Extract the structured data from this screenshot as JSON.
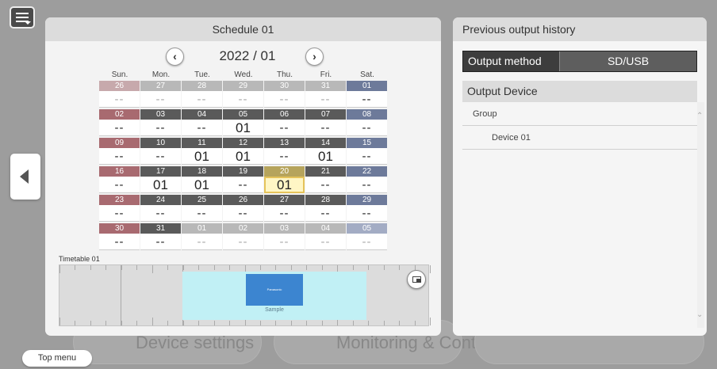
{
  "background": {
    "tiles": [
      {
        "label": "Device settings"
      },
      {
        "label": "Monitoring & Control"
      }
    ]
  },
  "nav": {
    "top_menu_label": "Top menu"
  },
  "schedule": {
    "title": "Schedule 01",
    "month_label": "2022 / 01",
    "weekdays": [
      "Sun.",
      "Mon.",
      "Tue.",
      "Wed.",
      "Thu.",
      "Fri.",
      "Sat."
    ],
    "weeks": [
      [
        {
          "d": "26",
          "v": "--",
          "o": true
        },
        {
          "d": "27",
          "v": "--",
          "o": true
        },
        {
          "d": "28",
          "v": "--",
          "o": true
        },
        {
          "d": "29",
          "v": "--",
          "o": true
        },
        {
          "d": "30",
          "v": "--",
          "o": true
        },
        {
          "d": "31",
          "v": "--",
          "o": true
        },
        {
          "d": "01",
          "v": "--"
        }
      ],
      [
        {
          "d": "02",
          "v": "--"
        },
        {
          "d": "03",
          "v": "--"
        },
        {
          "d": "04",
          "v": "--"
        },
        {
          "d": "05",
          "v": "01"
        },
        {
          "d": "06",
          "v": "--"
        },
        {
          "d": "07",
          "v": "--"
        },
        {
          "d": "08",
          "v": "--"
        }
      ],
      [
        {
          "d": "09",
          "v": "--"
        },
        {
          "d": "10",
          "v": "--"
        },
        {
          "d": "11",
          "v": "01"
        },
        {
          "d": "12",
          "v": "01"
        },
        {
          "d": "13",
          "v": "--"
        },
        {
          "d": "14",
          "v": "01"
        },
        {
          "d": "15",
          "v": "--"
        }
      ],
      [
        {
          "d": "16",
          "v": "--"
        },
        {
          "d": "17",
          "v": "01"
        },
        {
          "d": "18",
          "v": "01"
        },
        {
          "d": "19",
          "v": "--"
        },
        {
          "d": "20",
          "v": "01",
          "today": true
        },
        {
          "d": "21",
          "v": "--"
        },
        {
          "d": "22",
          "v": "--"
        }
      ],
      [
        {
          "d": "23",
          "v": "--"
        },
        {
          "d": "24",
          "v": "--"
        },
        {
          "d": "25",
          "v": "--"
        },
        {
          "d": "26",
          "v": "--"
        },
        {
          "d": "27",
          "v": "--"
        },
        {
          "d": "28",
          "v": "--"
        },
        {
          "d": "29",
          "v": "--"
        }
      ],
      [
        {
          "d": "30",
          "v": "--"
        },
        {
          "d": "31",
          "v": "--"
        },
        {
          "d": "01",
          "v": "--",
          "o": true
        },
        {
          "d": "02",
          "v": "--",
          "o": true
        },
        {
          "d": "03",
          "v": "--",
          "o": true
        },
        {
          "d": "04",
          "v": "--",
          "o": true
        },
        {
          "d": "05",
          "v": "--",
          "o": true
        }
      ]
    ],
    "timetable_label": "Timetable 01",
    "slot": {
      "thumb_text": "Panasonic",
      "label": "Sample"
    }
  },
  "history": {
    "title": "Previous output history",
    "output_method_label": "Output method",
    "output_method_value": "SD/USB",
    "output_device_label": "Output Device",
    "group_label": "Group",
    "device_label": "Device 01"
  },
  "colors": {
    "sunday": "#a86a70",
    "saturday": "#6d7a9a",
    "weekday": "#5a5a5a",
    "today_highlight": "#e5c35a",
    "timeline_slot": "#c1f0f5"
  }
}
